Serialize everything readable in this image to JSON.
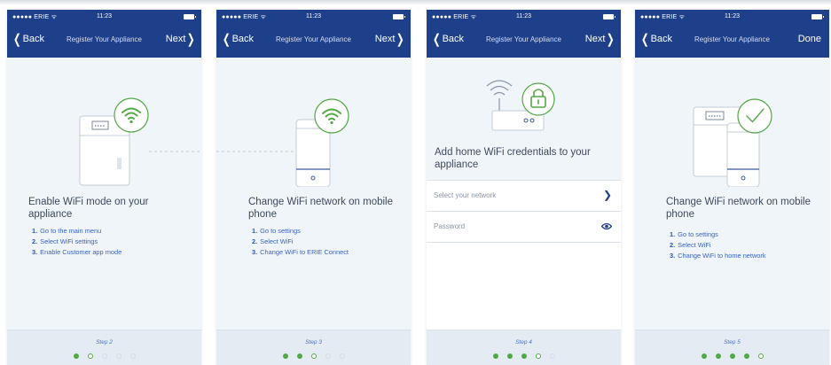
{
  "status_bar": {
    "carrier": "●●●●● ERIE ᯤ",
    "time": "11:23"
  },
  "screens": [
    {
      "nav": {
        "back": "Back",
        "title": "Register Your Appliance",
        "next": "Next"
      },
      "heading": "Enable WiFi mode on your appliance",
      "steps": [
        {
          "num": "1.",
          "text": "Go to the main menu"
        },
        {
          "num": "2.",
          "text": "Select WiFi settings"
        },
        {
          "num": "3.",
          "text": "Enable Customer app mode"
        }
      ],
      "footer": {
        "step_label": "Step 2",
        "dots": [
          "done",
          "current",
          "todo",
          "todo",
          "todo"
        ]
      }
    },
    {
      "nav": {
        "back": "Back",
        "title": "Register Your Appliance",
        "next": "Next"
      },
      "heading": "Change WiFi network on mobile phone",
      "steps": [
        {
          "num": "1.",
          "text": "Go to settings"
        },
        {
          "num": "2.",
          "text": "Select WiFi"
        },
        {
          "num": "3.",
          "text": "Change WiFi to ERIE Connect"
        }
      ],
      "footer": {
        "step_label": "Step 3",
        "dots": [
          "done",
          "done",
          "current",
          "todo",
          "todo"
        ]
      }
    },
    {
      "nav": {
        "back": "Back",
        "title": "Register Your Appliance",
        "next": "Next"
      },
      "heading": "Add home WiFi credentials to your appliance",
      "fields": {
        "network_label": "Select your network",
        "password_label": "Password"
      },
      "footer": {
        "step_label": "Step 4",
        "dots": [
          "done",
          "done",
          "done",
          "current",
          "todo"
        ]
      }
    },
    {
      "nav": {
        "back": "Back",
        "title": "Register Your Appliance",
        "next": "Done"
      },
      "heading": "Change WiFi network on mobile phone",
      "steps": [
        {
          "num": "1.",
          "text": "Go to settings"
        },
        {
          "num": "2.",
          "text": "Select WiFi"
        },
        {
          "num": "3.",
          "text": "Change WiFi to home network"
        }
      ],
      "footer": {
        "step_label": "Step 5",
        "dots": [
          "done",
          "done",
          "done",
          "done",
          "current"
        ]
      }
    }
  ],
  "colors": {
    "nav_bar": "#1e3f8a",
    "accent_green": "#52a845",
    "step_text": "#3a63c2",
    "background": "#f0f5fa"
  }
}
